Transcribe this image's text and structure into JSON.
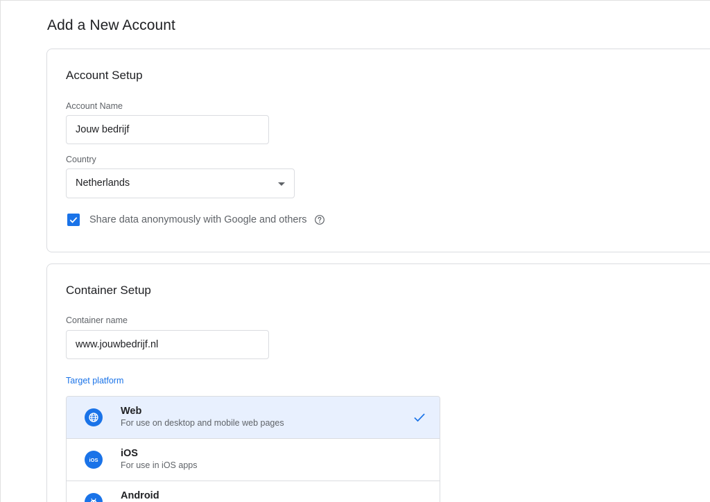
{
  "page": {
    "title": "Add a New Account"
  },
  "account_setup": {
    "title": "Account Setup",
    "account_name": {
      "label": "Account Name",
      "value": "Jouw bedrijf"
    },
    "country": {
      "label": "Country",
      "selected": "Netherlands"
    },
    "share_data": {
      "label": "Share data anonymously with Google and others",
      "checked": true
    }
  },
  "container_setup": {
    "title": "Container Setup",
    "container_name": {
      "label": "Container name",
      "value": "www.jouwbedrijf.nl"
    },
    "target_platform": {
      "label": "Target platform",
      "options": [
        {
          "name": "Web",
          "description": "For use on desktop and mobile web pages",
          "icon": "globe-icon",
          "selected": true
        },
        {
          "name": "iOS",
          "description": "For use in iOS apps",
          "icon": "ios-icon",
          "selected": false
        },
        {
          "name": "Android",
          "description": "",
          "icon": "android-icon",
          "selected": false
        }
      ]
    }
  },
  "colors": {
    "accent": "#1a73e8",
    "selected_bg": "#e8f0fe",
    "border": "#dadce0"
  }
}
